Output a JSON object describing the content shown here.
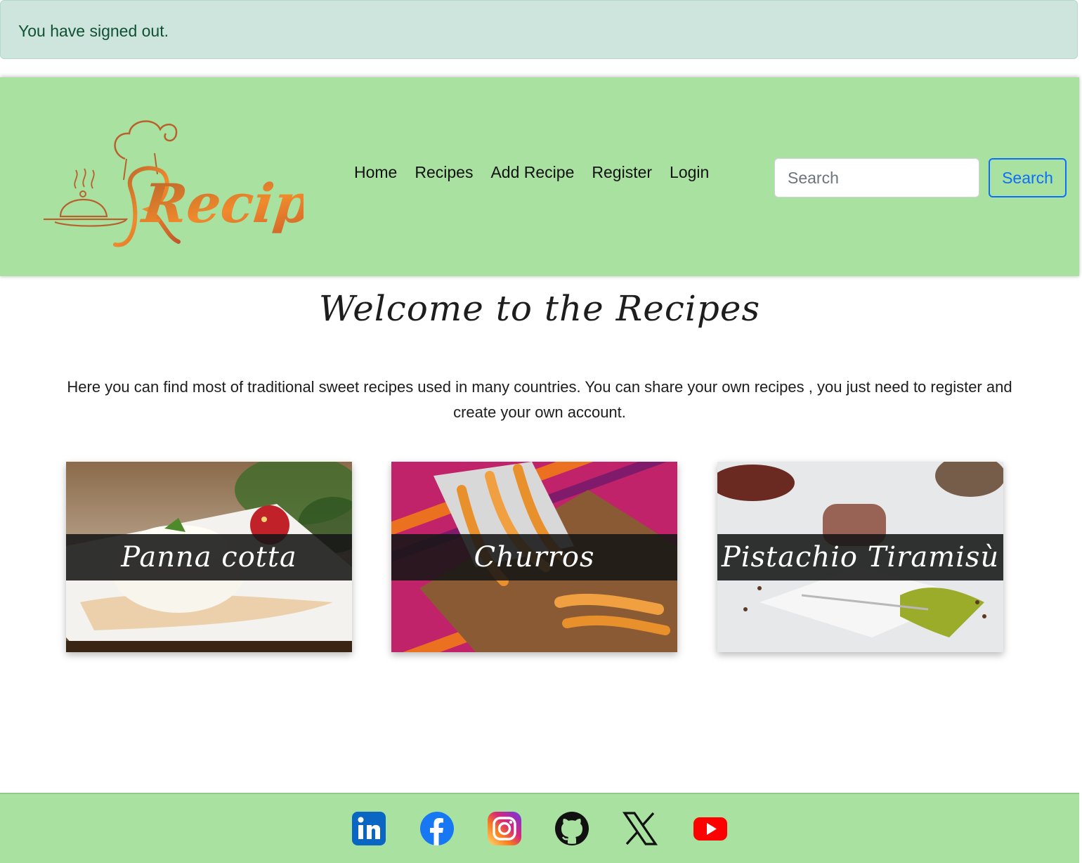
{
  "alert": {
    "message": "You have signed out."
  },
  "header": {
    "logo_text": "Recipes",
    "nav": [
      "Home",
      "Recipes",
      "Add Recipe",
      "Register",
      "Login"
    ],
    "search": {
      "placeholder": "Search",
      "button_label": "Search"
    }
  },
  "main": {
    "title": "Welcome to the Recipes",
    "intro": "Here you can find most of traditional sweet recipes used in many countries. You can share your own recipes , you just need to register and create your own account.",
    "cards": [
      {
        "title": "Panna cotta"
      },
      {
        "title": "Churros"
      },
      {
        "title": "Pistachio Tiramisù"
      }
    ]
  },
  "footer": {
    "social": [
      "linkedin-icon",
      "facebook-icon",
      "instagram-icon",
      "github-icon",
      "x-icon",
      "youtube-icon"
    ]
  },
  "colors": {
    "header_bg": "#a9e2a0",
    "alert_bg": "#cde5dc",
    "alert_text": "#0f5132",
    "accent": "#0d6efd",
    "logo_orange": "#e07a2a"
  }
}
